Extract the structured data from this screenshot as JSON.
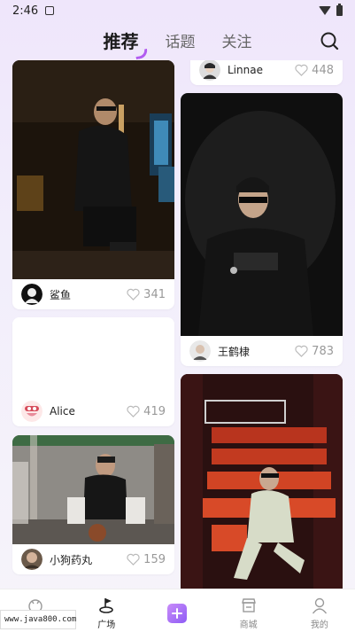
{
  "status_bar": {
    "time": "2:46"
  },
  "top_tabs": [
    {
      "label": "推荐",
      "active": true
    },
    {
      "label": "话题",
      "active": false
    },
    {
      "label": "关注",
      "active": false
    }
  ],
  "feed": {
    "left": [
      {
        "author": "鲨鱼",
        "likes": "341",
        "photo": "dark-room-photo"
      },
      {
        "author": "Alice",
        "likes": "419",
        "photo": "blank-photo"
      },
      {
        "author": "小狗药丸",
        "likes": "159",
        "photo": "gym-photo"
      }
    ],
    "right": [
      {
        "author": "Linnae",
        "likes": "448",
        "photo": "cropped-photo"
      },
      {
        "author": "王鹤棣",
        "likes": "783",
        "photo": "portrait-photo"
      },
      {
        "author": "",
        "likes": "",
        "photo": "theater-photo"
      }
    ]
  },
  "bottom_nav": [
    {
      "label": "",
      "icon": "home-icon"
    },
    {
      "label": "广场",
      "icon": "square-icon",
      "active": true
    },
    {
      "label": "",
      "icon": "add-icon"
    },
    {
      "label": "商城",
      "icon": "shop-icon"
    },
    {
      "label": "我的",
      "icon": "profile-icon"
    }
  ],
  "watermark": "www.java800.com"
}
